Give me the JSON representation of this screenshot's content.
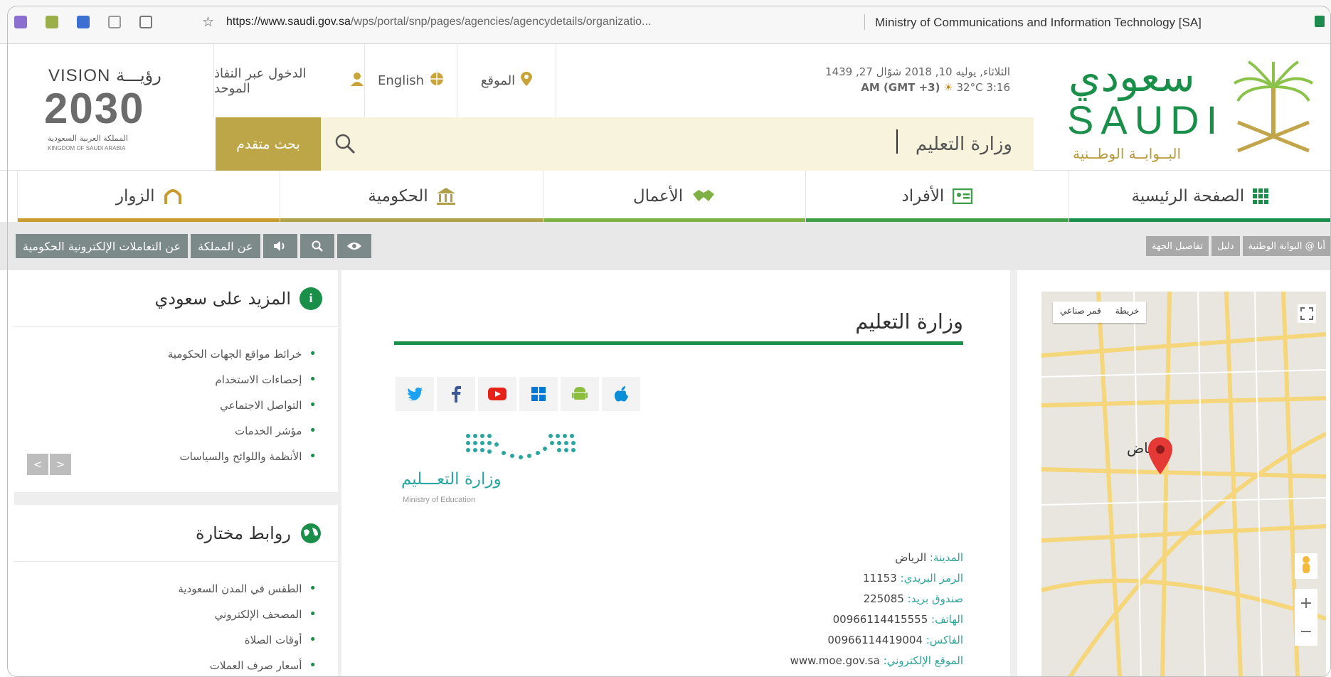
{
  "browser": {
    "url_domain": "https://www.saudi.gov.sa",
    "url_path": "/wps/portal/snp/pages/agencies/agencydetails/organizatio...",
    "tab_title": "Ministry of Communications and Information Technology [SA]"
  },
  "header": {
    "vision_word": "VISION رؤيـــة",
    "vision_year": "2030",
    "vision_ar": "المملكة العربية السعودية",
    "vision_en": "KINGDOM OF SAUDI ARABIA",
    "login_label": "الدخول عبر النفاذ الموحد",
    "english_label": "English",
    "location_label": "الموقع",
    "date_line": "الثلاثاء, يوليه 10, 2018 شوّال 27, 1439",
    "time_line": "AM (GMT +3)",
    "weather": "32°C 3:16",
    "advanced_search_label": "بحث متقدم",
    "search_value": "وزارة التعليم",
    "logo_ar": "سعودي",
    "logo_en": "SAUDI",
    "logo_sub": "البــوابــة الوطــنية"
  },
  "nav": {
    "items": [
      {
        "label": "الزوار",
        "color": "#c99a2e"
      },
      {
        "label": "الحكومية",
        "color": "#b0a04a"
      },
      {
        "label": "الأعمال",
        "color": "#7fb043"
      },
      {
        "label": "الأفراد",
        "color": "#3d9f4a"
      },
      {
        "label": "الصفحة الرئيسية",
        "color": "#1a8f4a"
      }
    ]
  },
  "strip": {
    "left": [
      "عن التعاملات الإلكترونية الحكومية",
      "عن المملكة"
    ],
    "right": [
      "تفاصيل الجهة",
      "دليل",
      "أنا @ البوابة الوطنية"
    ]
  },
  "sidebar": {
    "more_title": "المزيد على سعودي",
    "more_items": [
      "خرائط مواقع الجهات الحكومية",
      "إحصاءات الاستخدام",
      "التواصل الاجتماعي",
      "مؤشر الخدمات",
      "الأنظمة واللوائح والسياسات"
    ],
    "links_title": "روابط مختارة",
    "links_items": [
      "الطقس في المدن السعودية",
      "المصحف الإلكتروني",
      "أوقات الصلاة",
      "أسعار صرف العملات"
    ]
  },
  "org": {
    "title": "وزارة التعليم",
    "logo_ar": "وزارة التعـــليم",
    "logo_en": "Ministry of Education",
    "contact": [
      {
        "label": "المدينة:",
        "value": "الرياض"
      },
      {
        "label": "الرمز البريدي:",
        "value": "11153"
      },
      {
        "label": "صندوق بريد:",
        "value": "225085"
      },
      {
        "label": "الهاتف:",
        "value": "00966114415555"
      },
      {
        "label": "الفاكس:",
        "value": "00966114419004"
      },
      {
        "label": "الموقع الإلكتروني:",
        "value": "www.moe.gov.sa"
      }
    ]
  },
  "map": {
    "toggle_map": "خريطة",
    "toggle_sat": "قمر صناعي",
    "city": "الرياض",
    "zoom_in": "+",
    "zoom_out": "−"
  }
}
